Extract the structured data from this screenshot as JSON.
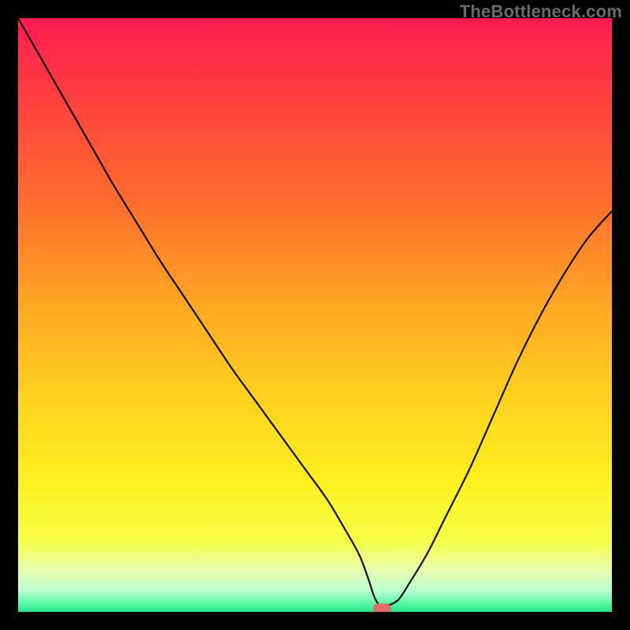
{
  "watermark": "TheBottleneck.com",
  "chart_data": {
    "type": "line",
    "title": "",
    "xlabel": "",
    "ylabel": "",
    "xlim": [
      0,
      100
    ],
    "ylim": [
      0,
      100
    ],
    "grid": false,
    "legend": false,
    "gradient_stops": [
      {
        "offset": 0.0,
        "color": "#ff1a52"
      },
      {
        "offset": 0.12,
        "color": "#ff3b3f"
      },
      {
        "offset": 0.3,
        "color": "#ff6a2e"
      },
      {
        "offset": 0.48,
        "color": "#ffa623"
      },
      {
        "offset": 0.64,
        "color": "#ffd21f"
      },
      {
        "offset": 0.78,
        "color": "#fff01f"
      },
      {
        "offset": 0.88,
        "color": "#f6ff45"
      },
      {
        "offset": 0.93,
        "color": "#e8ffb0"
      },
      {
        "offset": 0.965,
        "color": "#b8ffd0"
      },
      {
        "offset": 0.985,
        "color": "#5cf7a5"
      },
      {
        "offset": 1.0,
        "color": "#22e58b"
      }
    ],
    "series": [
      {
        "name": "bottleneck-curve",
        "stroke": "#111111",
        "stroke_width": 2.2,
        "x": [
          0,
          4,
          8,
          12,
          16,
          20,
          24,
          28,
          32,
          36,
          40,
          44,
          48,
          52,
          55,
          57.5,
          59,
          60,
          61,
          62,
          64,
          66,
          69,
          72,
          76,
          80,
          84,
          88,
          92,
          96,
          100
        ],
        "y": [
          100,
          93,
          86,
          79,
          72,
          65.5,
          59,
          53,
          47,
          41,
          35.5,
          30,
          24.5,
          19,
          14,
          9.5,
          5.5,
          2.5,
          1.0,
          1.0,
          2.0,
          5.0,
          10,
          16,
          24,
          33,
          42,
          50,
          57,
          63,
          67.5
        ]
      }
    ],
    "marker": {
      "name": "bottleneck-marker",
      "x": 61.3,
      "y": 0.6,
      "width": 3.0,
      "height": 1.6,
      "rx": 0.8,
      "fill": "#e46a63"
    }
  }
}
